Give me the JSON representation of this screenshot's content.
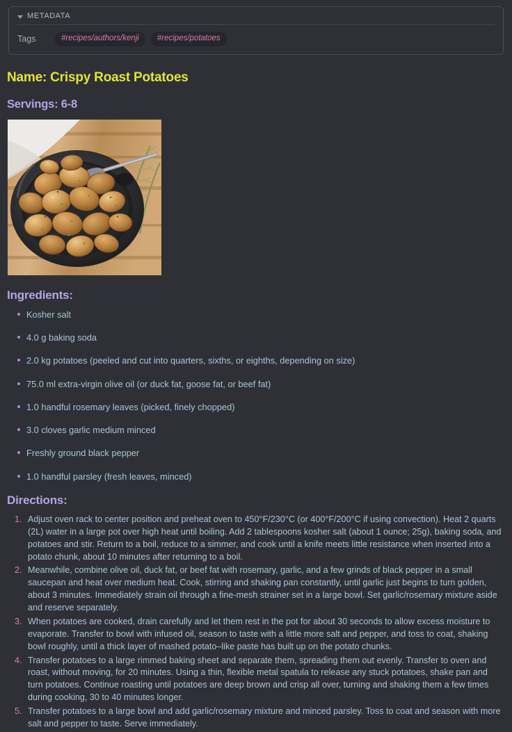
{
  "metadata": {
    "section_label": "METADATA",
    "caret_icon": "chevron-down-icon",
    "rows": [
      {
        "key": "Tags",
        "tags": [
          "#recipes/authors/kenji",
          "#recipes/potatoes"
        ]
      }
    ]
  },
  "recipe": {
    "name_line": "Name: Crispy Roast Potatoes",
    "servings_line": "Servings: 6-8",
    "photo_alt": "Crispy roast potatoes in a cast iron skillet with rosemary on a wooden board",
    "ingredients_heading": "Ingredients:",
    "directions_heading": "Directions:",
    "ingredients": [
      "Kosher salt",
      "4.0 g baking soda",
      "2.0 kg potatoes (peeled and cut into quarters, sixths, or eighths, depending on size)",
      "75.0 ml extra-virgin olive oil (or duck fat, goose fat, or beef fat)",
      "1.0 handful rosemary leaves (picked, finely chopped)",
      "3.0 cloves garlic medium minced",
      "Freshly ground black pepper",
      "1.0 handful parsley (fresh leaves, minced)"
    ],
    "directions": [
      "Adjust oven rack to center position and preheat oven to 450°F/230°C (or 400°F/200°C if using convection). Heat 2 quarts (2L) water in a large pot over high heat until boiling. Add 2 tablespoons kosher salt (about 1 ounce; 25g), baking soda, and potatoes and stir. Return to a boil, reduce to a simmer, and cook until a knife meets little resistance when inserted into a potato chunk, about 10 minutes after returning to a boil.",
      "Meanwhile, combine olive oil, duck fat, or beef fat with rosemary, garlic, and a few grinds of black pepper in a small saucepan and heat over medium heat. Cook, stirring and shaking pan constantly, until garlic just begins to turn golden, about 3 minutes. Immediately strain oil through a fine-mesh strainer set in a large bowl. Set garlic/rosemary mixture aside and reserve separately.",
      "When potatoes are cooked, drain carefully and let them rest in the pot for about 30 seconds to allow excess moisture to evaporate. Transfer to bowl with infused oil, season to taste with a little more salt and pepper, and toss to coat, shaking bowl roughly, until a thick layer of mashed potato–like paste has built up on the potato chunks.",
      "Transfer potatoes to a large rimmed baking sheet and separate them, spreading them out evenly. Transfer to oven and roast, without moving, for 20 minutes. Using a thin, flexible metal spatula to release any stuck potatoes, shake pan and turn potatoes. Continue roasting until potatoes are deep brown and crisp all over, turning and shaking them a few times during cooking, 30 to 40 minutes longer.",
      "Transfer potatoes to a large bowl and add garlic/rosemary mixture and minced parsley. Toss to coat and season with more salt and pepper to taste. Serve immediately."
    ]
  },
  "colors": {
    "background": "#2e3036",
    "title_yellow": "#e5e338",
    "heading_purple": "#b3a5e6",
    "body_text": "#a8c6d4",
    "tag_pink": "#d77ab4",
    "list_number_pink": "#d97ab2",
    "panel_border": "#4c4e56"
  }
}
